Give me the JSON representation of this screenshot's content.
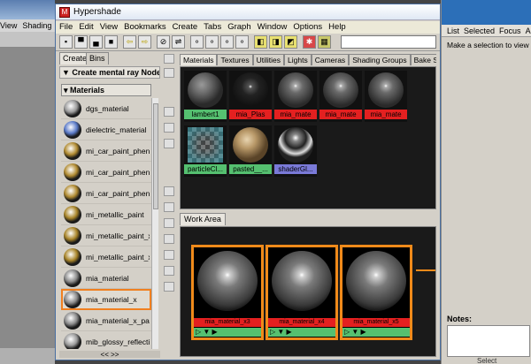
{
  "bg_app": {
    "menu": [
      "View",
      "Shading"
    ],
    "right_menu": [
      "List",
      "Selected",
      "Focus",
      "A"
    ],
    "right_message": "Make a selection to view at",
    "notes_label": "Notes:",
    "select_label": "Select"
  },
  "window": {
    "title": "Hypershade",
    "menu": [
      "File",
      "Edit",
      "View",
      "Bookmarks",
      "Create",
      "Tabs",
      "Graph",
      "Window",
      "Options",
      "Help"
    ]
  },
  "create_panel": {
    "tabs": [
      "Create",
      "Bins"
    ],
    "header": "Create mental ray Nodes",
    "section": "Materials",
    "items": [
      {
        "label": "dgs_material",
        "icon": "gray-sphere-icon",
        "color": "#9a9a9a"
      },
      {
        "label": "dielectric_material",
        "icon": "glass-icon",
        "color": "#5a7ac8"
      },
      {
        "label": "mi_car_paint_phen",
        "icon": "gold-sphere-icon",
        "color": "#b08a30"
      },
      {
        "label": "mi_car_paint_phen_",
        "icon": "gold-sphere-icon",
        "color": "#b08a30"
      },
      {
        "label": "mi_car_paint_phen_",
        "icon": "gold-sphere-icon",
        "color": "#b08a30"
      },
      {
        "label": "mi_metallic_paint",
        "icon": "gold-sphere-icon",
        "color": "#a88428"
      },
      {
        "label": "mi_metallic_paint_x",
        "icon": "gold-sphere-icon",
        "color": "#a88428"
      },
      {
        "label": "mi_metallic_paint_x",
        "icon": "gold-sphere-icon",
        "color": "#a88428"
      },
      {
        "label": "mia_material",
        "icon": "gray-sphere-icon",
        "color": "#8a8a8a"
      },
      {
        "label": "mia_material_x",
        "icon": "gray-sphere-icon",
        "color": "#8a8a8a",
        "selected": true
      },
      {
        "label": "mia_material_x_pass",
        "icon": "gray-sphere-icon",
        "color": "#8a8a8a"
      },
      {
        "label": "mib_glossy_reflectio",
        "icon": "gray-sphere-icon",
        "color": "#9a9a9a"
      }
    ],
    "bottom": "<<     >>"
  },
  "tabs": [
    "Materials",
    "Textures",
    "Utilities",
    "Lights",
    "Cameras",
    "Shading Groups",
    "Bake S"
  ],
  "swatches": [
    {
      "name": "lambert1",
      "kind": "gray",
      "label_color": "#55c070"
    },
    {
      "name": "mia_Plas",
      "kind": "dark",
      "label_color": "#e42020"
    },
    {
      "name": "mia_mate",
      "kind": "gray-spec",
      "label_color": "#e42020"
    },
    {
      "name": "mia_mate",
      "kind": "gray-spec",
      "label_color": "#e42020"
    },
    {
      "name": "mia_mate",
      "kind": "gray-spec",
      "label_color": "#e42020"
    },
    {
      "name": "particleCl...",
      "kind": "checker",
      "label_color": "#55c070"
    },
    {
      "name": "pasted__...",
      "kind": "sand",
      "label_color": "#55c070"
    },
    {
      "name": "shaderGl...",
      "kind": "chrome",
      "label_color": "#7a7ad8"
    }
  ],
  "work_area": {
    "tab": "Work Area",
    "nodes": [
      {
        "label": "mia_material_x3"
      },
      {
        "label": "mia_material_x4"
      },
      {
        "label": "mia_material_x5"
      }
    ]
  }
}
